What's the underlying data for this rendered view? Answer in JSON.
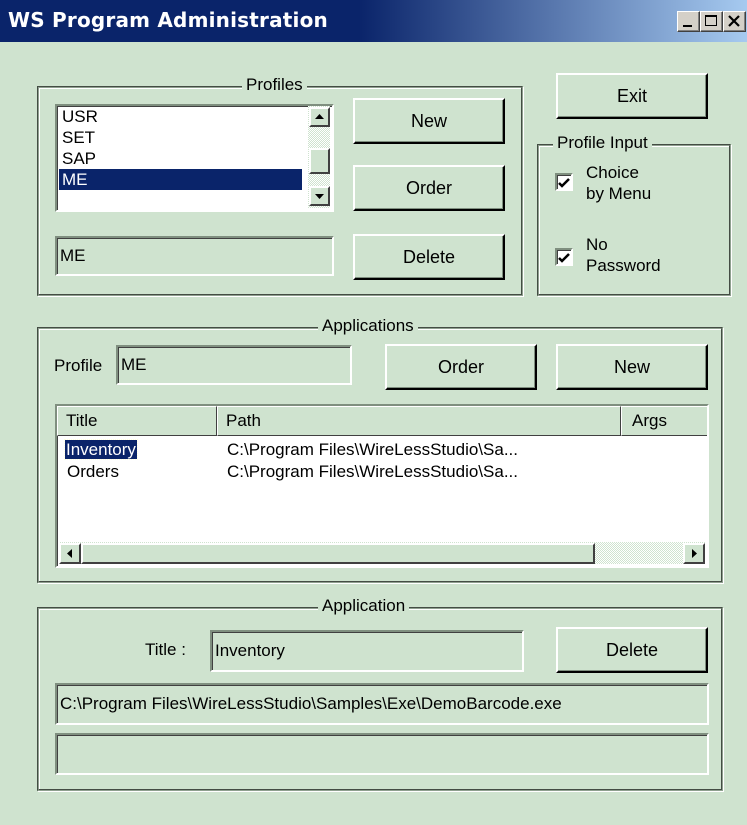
{
  "window": {
    "title": "WS Program Administration"
  },
  "profiles": {
    "legend": "Profiles",
    "items": [
      "USR",
      "SET",
      "SAP",
      "ME"
    ],
    "selected_index": 3,
    "current_value": "ME",
    "new_label": "New",
    "order_label": "Order",
    "delete_label": "Delete"
  },
  "exit_label": "Exit",
  "profile_input": {
    "legend": "Profile Input",
    "choice_by_menu": {
      "line1": "Choice",
      "line2": "by Menu",
      "checked": true
    },
    "no_password": {
      "line1": "No",
      "line2": "Password",
      "checked": true
    }
  },
  "applications": {
    "legend": "Applications",
    "profile_label": "Profile",
    "profile_value": "ME",
    "order_label": "Order",
    "new_label": "New",
    "columns": [
      "Title",
      "Path",
      "Args"
    ],
    "rows": [
      {
        "title": "Inventory",
        "path": "C:\\Program Files\\WireLessStudio\\Sa...",
        "args": ""
      },
      {
        "title": "Orders",
        "path": "C:\\Program Files\\WireLessStudio\\Sa...",
        "args": ""
      }
    ]
  },
  "application": {
    "legend": "Application",
    "title_label": "Title :",
    "title_value": "Inventory",
    "delete_label": "Delete",
    "path_value": "C:\\Program Files\\WireLessStudio\\Samples\\Exe\\DemoBarcode.exe",
    "args_value": ""
  },
  "colors": {
    "titlebar": "#0a246a",
    "background": "#cfe3cf",
    "selection": "#0a246a"
  },
  "icons": [
    "minimize-icon",
    "maximize-icon",
    "close-icon",
    "scroll-up-arrow-icon",
    "scroll-down-arrow-icon",
    "scroll-left-arrow-icon",
    "scroll-right-arrow-icon",
    "checkmark-icon"
  ]
}
